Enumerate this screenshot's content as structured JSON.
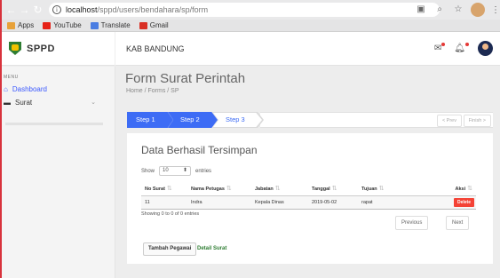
{
  "browser": {
    "url_host": "localhost",
    "url_path": "/sppd/users/bendahara/sp/form",
    "bookmarks": [
      {
        "label": "Apps",
        "icon": "apps-grid-icon",
        "color": "#e8a23a"
      },
      {
        "label": "YouTube",
        "icon": "youtube-icon",
        "color": "#e62117"
      },
      {
        "label": "Translate",
        "icon": "translate-icon",
        "color": "#4a7de2"
      },
      {
        "label": "Gmail",
        "icon": "gmail-icon",
        "color": "#d93025"
      }
    ]
  },
  "header": {
    "brand": "SPPD",
    "region": "KAB BANDUNG"
  },
  "sidebar": {
    "menu_heading": "MENU",
    "items": [
      {
        "label": "Dashboard",
        "icon": "home-icon",
        "active": true
      },
      {
        "label": "Surat",
        "icon": "envelope-icon",
        "active": false
      }
    ]
  },
  "main": {
    "title": "Form Surat Perintah",
    "breadcrumb": "Home / Forms / SP",
    "steps": [
      "Step 1",
      "Step 2",
      "Step 3"
    ],
    "prev_label": "< Prev",
    "finish_label": "Finish >",
    "card_title": "Data Berhasil Tersimpan",
    "show_label": "Show",
    "show_value": "10",
    "entries_label": "entries",
    "columns": [
      "No Surat",
      "Nama Petugas",
      "Jabatan",
      "Tanggal",
      "Tujuan",
      "Aksi"
    ],
    "rows": [
      {
        "no": "11",
        "nama": "Indra",
        "jabatan": "Kepala Dinas",
        "tanggal": "2019-05-02",
        "tujuan": "rapat",
        "aksi": "Delete"
      }
    ],
    "info": "Showing 0 to 0 of 0 entries",
    "previous": "Previous",
    "next": "Next",
    "add_button": "Tambah Pegawai",
    "detail_link": "Detail Surat"
  },
  "colors": {
    "accent": "#3d6cf5",
    "delete": "#f44336",
    "link_green": "#2e7d32"
  }
}
